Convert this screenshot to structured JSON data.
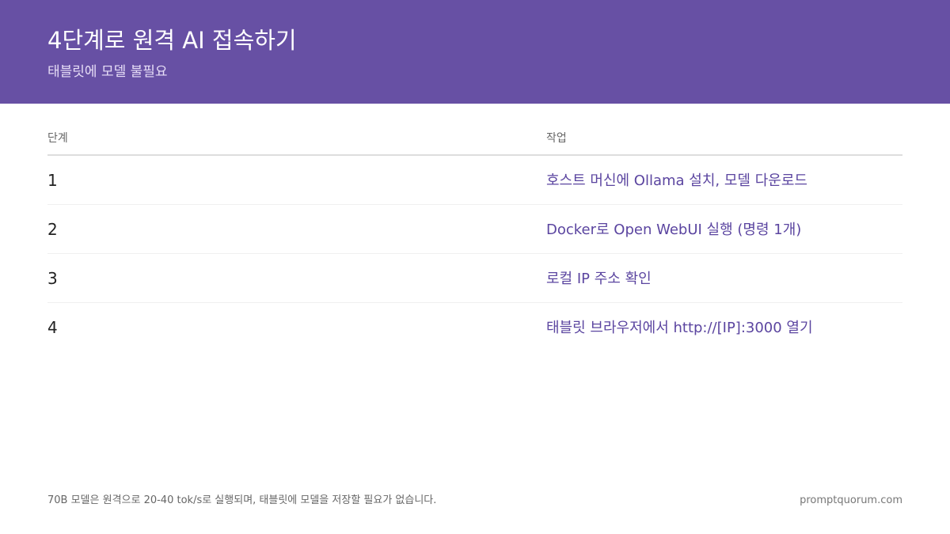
{
  "header": {
    "title": "4단계로 원격 AI 접속하기",
    "subtitle": "태블릿에 모델 불필요"
  },
  "table": {
    "headers": [
      "단계",
      "작업"
    ],
    "rows": [
      {
        "step": "1",
        "task": "호스트 머신에 Ollama 설치, 모델 다운로드"
      },
      {
        "step": "2",
        "task": "Docker로  Open WebUI 실행 (명령 1개)"
      },
      {
        "step": "3",
        "task": "로컬 IP 주소 확인"
      },
      {
        "step": "4",
        "task": "태블릿 브라우저에서 http://[IP]:3000 열기"
      }
    ]
  },
  "footer": {
    "note": "70B 모델은 원격으로 20-40 tok/s로 실행되며, 태블릿에 모델을 저장할 필요가 없습니다.",
    "site": "promptquorum.com"
  },
  "colors": {
    "header_bg": "#6750a4",
    "accent": "#5b45a0"
  }
}
